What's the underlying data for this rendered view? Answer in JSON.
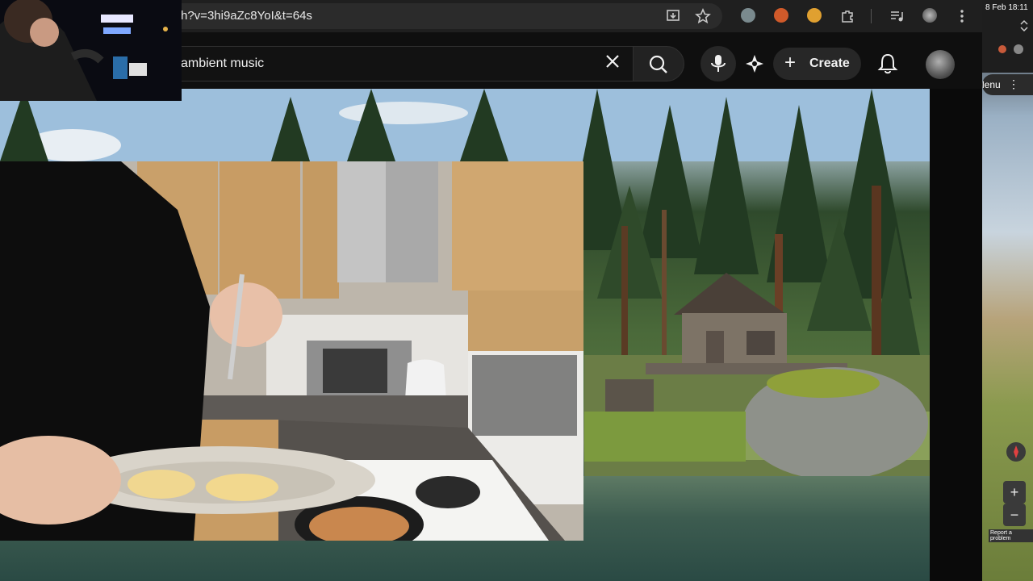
{
  "browser": {
    "url": "h?v=3hi9aZc8YoI&t=64s",
    "icons": [
      "install-icon",
      "star-icon",
      "extension-icon",
      "extension-icon",
      "extension-icon",
      "puzzle-icon",
      "media-icon",
      "profile-icon",
      "more-vert-icon"
    ]
  },
  "youtube": {
    "search_query": "ambient music",
    "create_label": "Create"
  },
  "side_panel": {
    "clock": "8 Feb  18:11",
    "menu_label": "lenu",
    "report_label": "Report a problem"
  },
  "colors": {
    "header_bg": "#0f0f0f",
    "chrome_bg": "#1f1f1f",
    "chip_bg": "#272727"
  }
}
